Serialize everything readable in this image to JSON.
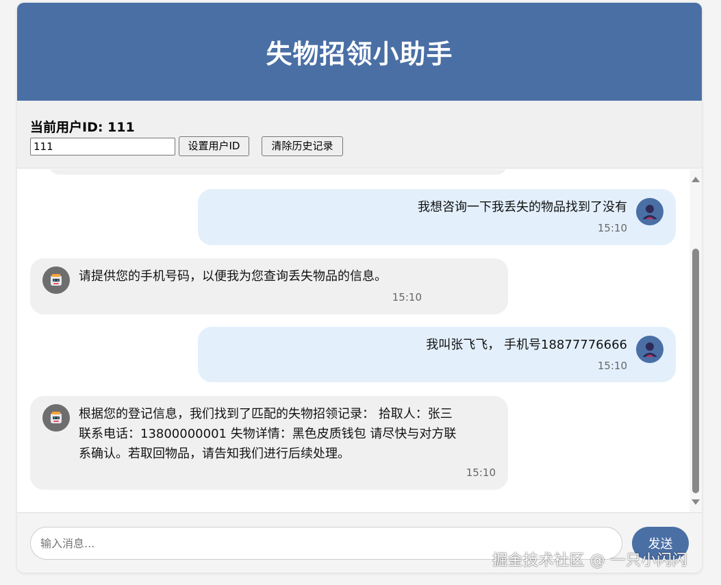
{
  "header": {
    "title": "失物招领小助手"
  },
  "userbar": {
    "current_label": "当前用户ID: 111",
    "user_id_value": "111",
    "set_button": "设置用户ID",
    "clear_button": "清除历史记录"
  },
  "messages": [
    {
      "role": "user",
      "text": "我想咨询一下我丢失的物品找到了没有",
      "time": "15:10"
    },
    {
      "role": "bot",
      "text": "请提供您的手机号码，以便我为您查询丢失物品的信息。",
      "time": "15:10"
    },
    {
      "role": "user",
      "text": "我叫张飞飞， 手机号18877776666",
      "time": "15:10"
    },
    {
      "role": "bot",
      "lines": [
        "根据您的登记信息，我们找到了匹配的失物招领记录： 拾取人：张三",
        "联系电话：13800000001 失物详情：黑色皮质钱包 请尽快与对方联",
        "系确认。若取回物品，请告知我们进行后续处理。"
      ],
      "time": "15:10"
    }
  ],
  "input": {
    "placeholder": "输入消息...",
    "send_button": "发送"
  },
  "watermark": "掘金技术社区 @ 一只小闪闪",
  "colors": {
    "primary": "#4a6fa5",
    "user_bubble": "#e3f0fc",
    "bot_bubble": "#f0f0f0"
  },
  "icons": {
    "user_avatar": "user-silhouette-icon",
    "bot_avatar": "robot-icon"
  }
}
